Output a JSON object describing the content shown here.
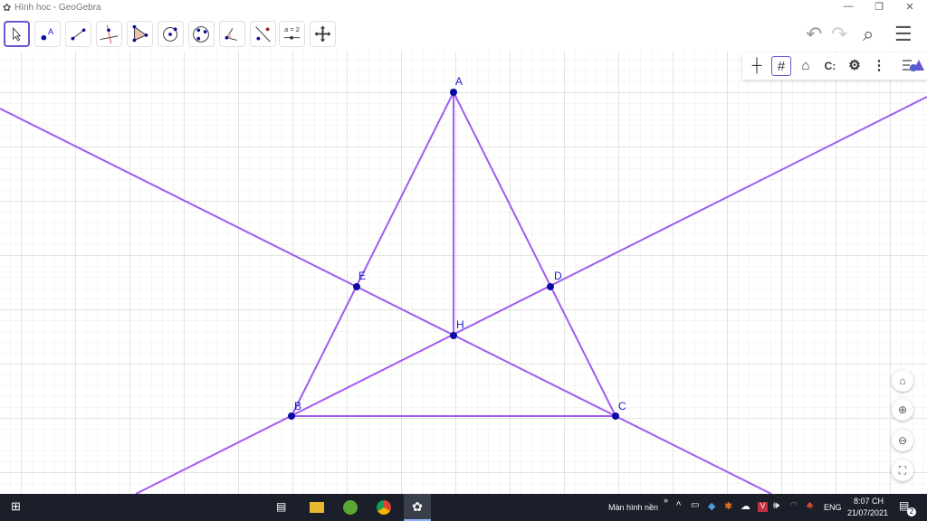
{
  "window": {
    "title": "Hình hoc - GeoGebra",
    "minimize": "—",
    "restore": "❐",
    "close": "✕"
  },
  "toolbar": {
    "tools": [
      "move",
      "point",
      "segment",
      "perpendicular-line",
      "polygon",
      "circle-center-point",
      "circle-three-points",
      "angle",
      "reflect",
      "slider",
      "move-graphics-view"
    ],
    "slider_text": "a = 2",
    "undo": "↶",
    "redo": "↷",
    "search": "⌕",
    "menu": "☰"
  },
  "style_bar": {
    "axes": "┼",
    "grid": "#",
    "home": "⌂",
    "view": "C:",
    "settings": "⚙",
    "more": "⋮"
  },
  "view_buttons": {
    "home": "⌂",
    "zoom_in": "⊕",
    "zoom_out": "⊖",
    "fullscreen": "⛶"
  },
  "points": {
    "A": "A",
    "B": "B",
    "C": "C",
    "D": "D",
    "E": "E",
    "H": "H"
  },
  "colors": {
    "line": "#a05cf0",
    "point": "#0a0aa0",
    "label": "#1a1ad0"
  },
  "taskbar": {
    "desktop": "Màn hình nền",
    "chevron": "»",
    "lang": "ENG",
    "time": "8:07 CH",
    "date": "21/07/2021",
    "notifications": "2"
  }
}
